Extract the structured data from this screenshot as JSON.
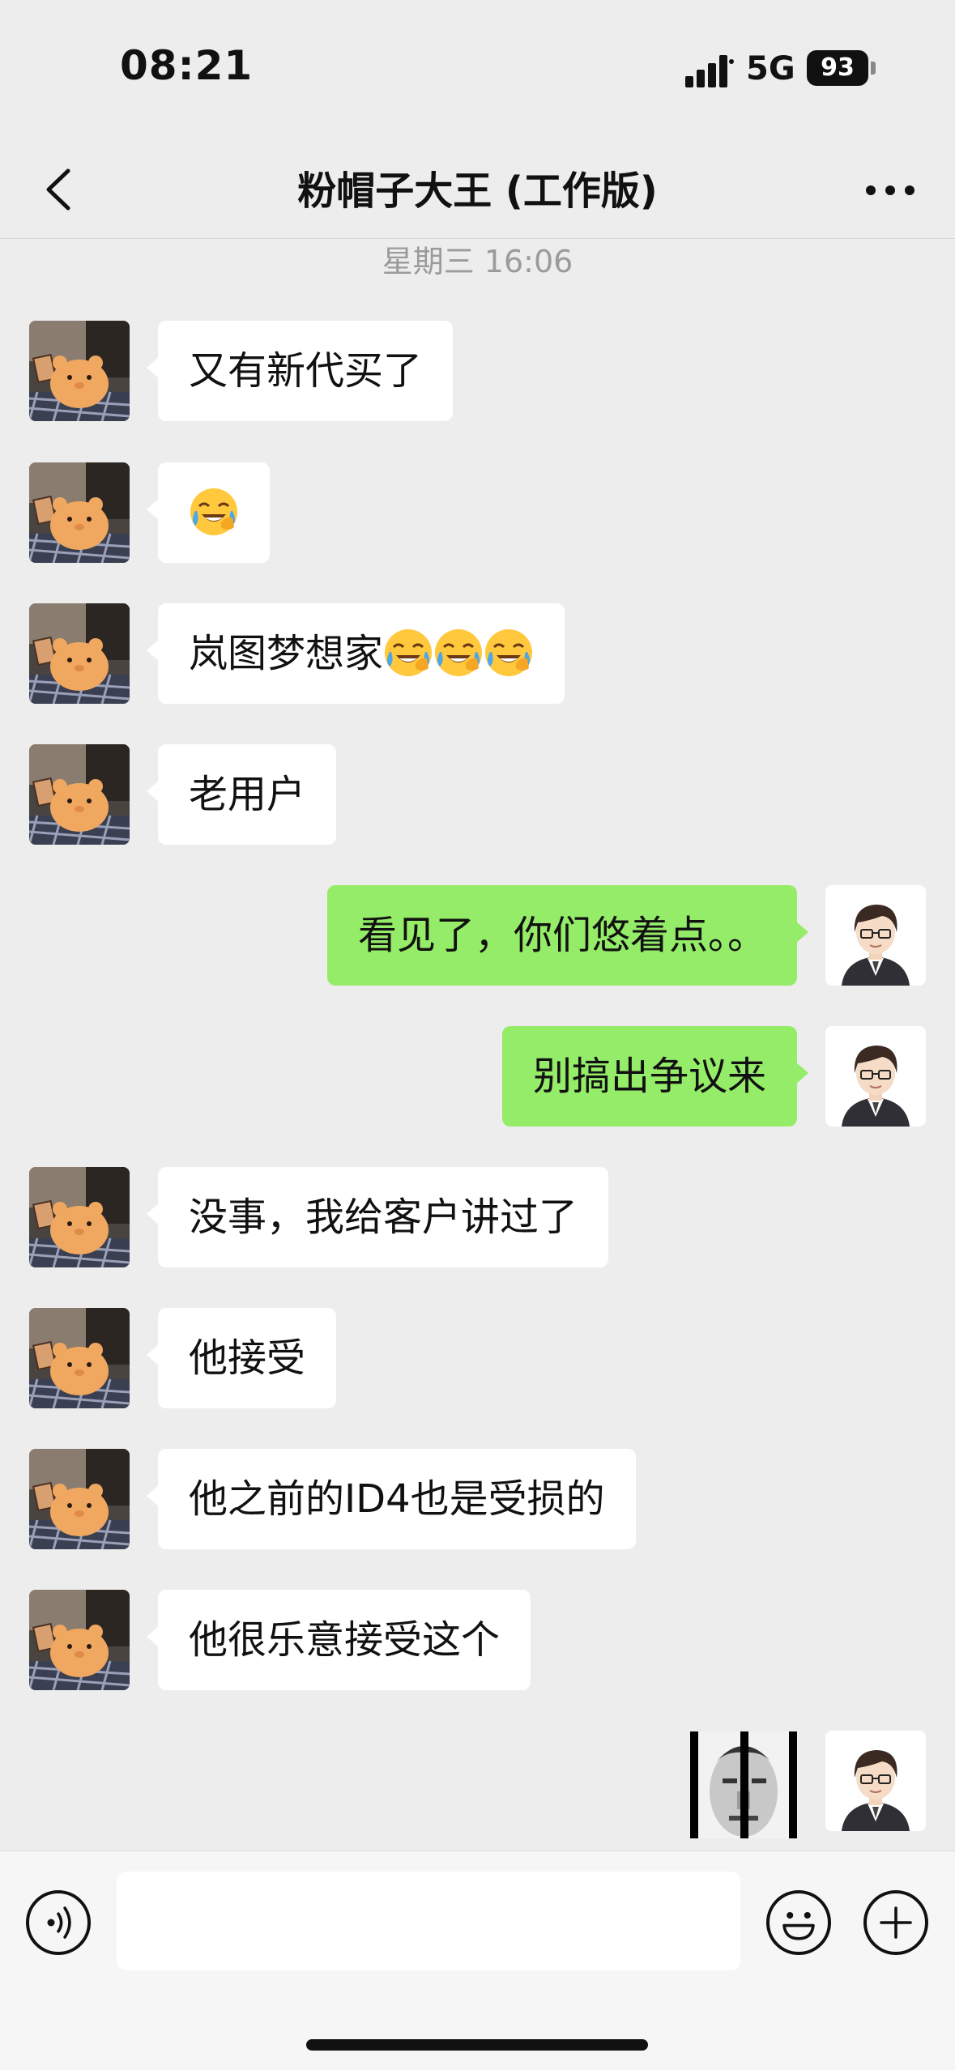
{
  "status_bar": {
    "time": "08:21",
    "network": "5G",
    "battery": "93"
  },
  "header": {
    "title": "粉帽子大王 (工作版)",
    "back_icon": "chevron-left-icon",
    "more_icon": "more-dots-icon"
  },
  "timestamp": "星期三 16:06",
  "messages": [
    {
      "side": "left",
      "text": "又有新代买了"
    },
    {
      "side": "left",
      "text": "",
      "emoji_count": 1
    },
    {
      "side": "left",
      "text": "岚图梦想家",
      "emoji_count": 3
    },
    {
      "side": "left",
      "text": "老用户"
    },
    {
      "side": "right",
      "text": "看见了，你们悠着点。。"
    },
    {
      "side": "right",
      "text": "别搞出争议来"
    },
    {
      "side": "left",
      "text": "没事，我给客户讲过了"
    },
    {
      "side": "left",
      "text": "他接受"
    },
    {
      "side": "left",
      "text": "他之前的ID4也是受损的"
    },
    {
      "side": "left",
      "text": "他很乐意接受这个"
    },
    {
      "side": "right",
      "type": "sticker"
    }
  ],
  "input_bar": {
    "voice_icon": "voice-icon",
    "emoji_icon": "emoji-icon",
    "plus_icon": "plus-icon",
    "placeholder": ""
  },
  "colors": {
    "background": "#ededed",
    "self_bubble": "#95ec69",
    "other_bubble": "#ffffff"
  }
}
